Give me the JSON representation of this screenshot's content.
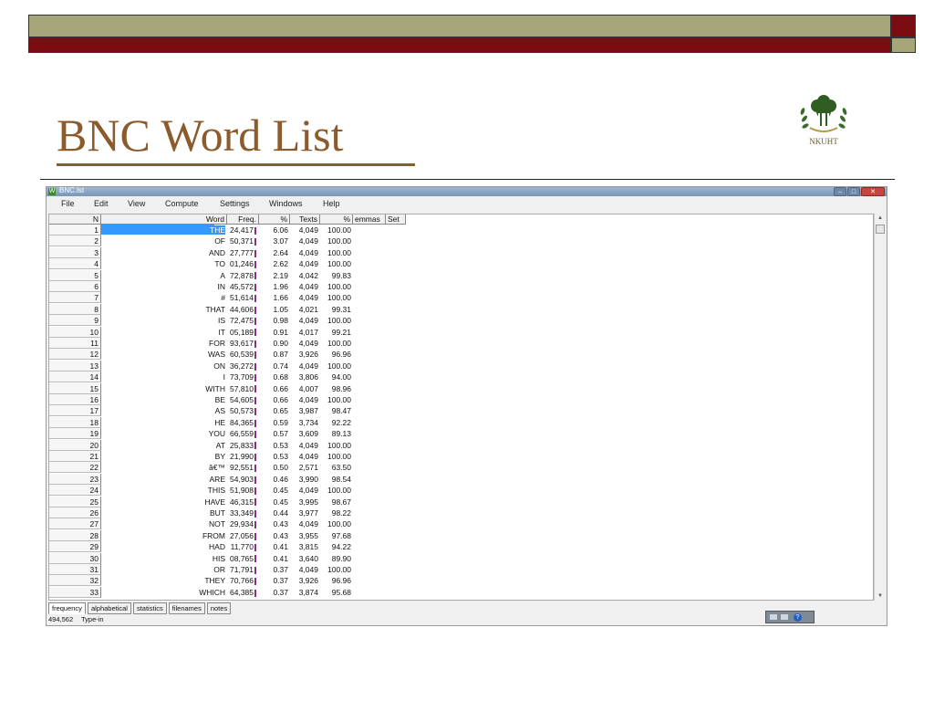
{
  "slide": {
    "title": "BNC Word List",
    "logo_text": "NKUHT"
  },
  "window": {
    "title": "BNC.lst",
    "icon_letter": "W",
    "menu": [
      "File",
      "Edit",
      "View",
      "Compute",
      "Settings",
      "Windows",
      "Help"
    ]
  },
  "table": {
    "headers": {
      "n": "N",
      "word": "Word",
      "freq": "Freq.",
      "pct": "%",
      "texts": "Texts",
      "texts_pct": "%",
      "lemmas": "emmas",
      "set": "Set"
    },
    "rows": [
      {
        "n": "1",
        "word": "THE",
        "freq": "24,417",
        "pct": "6.06",
        "texts": "4,049",
        "tpct": "100.00"
      },
      {
        "n": "2",
        "word": "OF",
        "freq": "50,371",
        "pct": "3.07",
        "texts": "4,049",
        "tpct": "100.00"
      },
      {
        "n": "3",
        "word": "AND",
        "freq": "27,777",
        "pct": "2.64",
        "texts": "4,049",
        "tpct": "100.00"
      },
      {
        "n": "4",
        "word": "TO",
        "freq": "01,246",
        "pct": "2.62",
        "texts": "4,049",
        "tpct": "100.00"
      },
      {
        "n": "5",
        "word": "A",
        "freq": "72,878",
        "pct": "2.19",
        "texts": "4,042",
        "tpct": "99.83"
      },
      {
        "n": "6",
        "word": "IN",
        "freq": "45,572",
        "pct": "1.96",
        "texts": "4,049",
        "tpct": "100.00"
      },
      {
        "n": "7",
        "word": "#",
        "freq": "51,614",
        "pct": "1.66",
        "texts": "4,049",
        "tpct": "100.00"
      },
      {
        "n": "8",
        "word": "THAT",
        "freq": "44,606",
        "pct": "1.05",
        "texts": "4,021",
        "tpct": "99.31"
      },
      {
        "n": "9",
        "word": "IS",
        "freq": "72,475",
        "pct": "0.98",
        "texts": "4,049",
        "tpct": "100.00"
      },
      {
        "n": "10",
        "word": "IT",
        "freq": "05,189",
        "pct": "0.91",
        "texts": "4,017",
        "tpct": "99.21"
      },
      {
        "n": "11",
        "word": "FOR",
        "freq": "93,617",
        "pct": "0.90",
        "texts": "4,049",
        "tpct": "100.00"
      },
      {
        "n": "12",
        "word": "WAS",
        "freq": "60,539",
        "pct": "0.87",
        "texts": "3,926",
        "tpct": "96.96"
      },
      {
        "n": "13",
        "word": "ON",
        "freq": "36,272",
        "pct": "0.74",
        "texts": "4,049",
        "tpct": "100.00"
      },
      {
        "n": "14",
        "word": "I",
        "freq": "73,709",
        "pct": "0.68",
        "texts": "3,806",
        "tpct": "94.00"
      },
      {
        "n": "15",
        "word": "WITH",
        "freq": "57,810",
        "pct": "0.66",
        "texts": "4,007",
        "tpct": "98.96"
      },
      {
        "n": "16",
        "word": "BE",
        "freq": "54,605",
        "pct": "0.66",
        "texts": "4,049",
        "tpct": "100.00"
      },
      {
        "n": "17",
        "word": "AS",
        "freq": "50,573",
        "pct": "0.65",
        "texts": "3,987",
        "tpct": "98.47"
      },
      {
        "n": "18",
        "word": "HE",
        "freq": "84,365",
        "pct": "0.59",
        "texts": "3,734",
        "tpct": "92.22"
      },
      {
        "n": "19",
        "word": "YOU",
        "freq": "66,559",
        "pct": "0.57",
        "texts": "3,609",
        "tpct": "89.13"
      },
      {
        "n": "20",
        "word": "AT",
        "freq": "25,833",
        "pct": "0.53",
        "texts": "4,049",
        "tpct": "100.00"
      },
      {
        "n": "21",
        "word": "BY",
        "freq": "21,990",
        "pct": "0.53",
        "texts": "4,049",
        "tpct": "100.00"
      },
      {
        "n": "22",
        "word": "â€™",
        "freq": "92,551",
        "pct": "0.50",
        "texts": "2,571",
        "tpct": "63.50"
      },
      {
        "n": "23",
        "word": "ARE",
        "freq": "54,903",
        "pct": "0.46",
        "texts": "3,990",
        "tpct": "98.54"
      },
      {
        "n": "24",
        "word": "THIS",
        "freq": "51,908",
        "pct": "0.45",
        "texts": "4,049",
        "tpct": "100.00"
      },
      {
        "n": "25",
        "word": "HAVE",
        "freq": "46,315",
        "pct": "0.45",
        "texts": "3,995",
        "tpct": "98.67"
      },
      {
        "n": "26",
        "word": "BUT",
        "freq": "33,349",
        "pct": "0.44",
        "texts": "3,977",
        "tpct": "98.22"
      },
      {
        "n": "27",
        "word": "NOT",
        "freq": "29,934",
        "pct": "0.43",
        "texts": "4,049",
        "tpct": "100.00"
      },
      {
        "n": "28",
        "word": "FROM",
        "freq": "27,056",
        "pct": "0.43",
        "texts": "3,955",
        "tpct": "97.68"
      },
      {
        "n": "29",
        "word": "HAD",
        "freq": "11,770",
        "pct": "0.41",
        "texts": "3,815",
        "tpct": "94.22"
      },
      {
        "n": "30",
        "word": "HIS",
        "freq": "08,765",
        "pct": "0.41",
        "texts": "3,640",
        "tpct": "89.90"
      },
      {
        "n": "31",
        "word": "OR",
        "freq": "71,791",
        "pct": "0.37",
        "texts": "4,049",
        "tpct": "100.00"
      },
      {
        "n": "32",
        "word": "THEY",
        "freq": "70,766",
        "pct": "0.37",
        "texts": "3,926",
        "tpct": "96.96"
      },
      {
        "n": "33",
        "word": "WHICH",
        "freq": "64,385",
        "pct": "0.37",
        "texts": "3,874",
        "tpct": "95.68"
      }
    ]
  },
  "tabs": [
    "frequency",
    "alphabetical",
    "statistics",
    "filenames",
    "notes"
  ],
  "status": {
    "count": "494,562",
    "mode": "Type-in"
  },
  "colors": {
    "olive": "#a7a679",
    "maroon": "#7b0c12",
    "title": "#8b5b2b",
    "selection": "#3399ff",
    "freq_bar": "#8a2f8a"
  }
}
